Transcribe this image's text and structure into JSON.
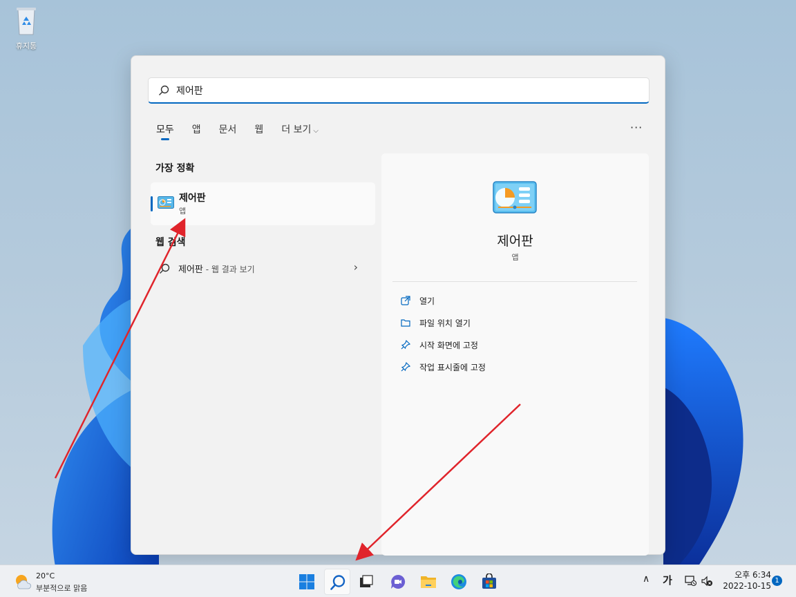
{
  "desktop": {
    "recycle_bin_label": "휴지통"
  },
  "search": {
    "query": "제어판",
    "tabs": [
      "모두",
      "앱",
      "문서",
      "웹",
      "더 보기"
    ],
    "active_tab": "모두",
    "more_options": "···"
  },
  "results": {
    "best_match_header": "가장 정확",
    "best_match": {
      "name": "제어판",
      "type": "앱"
    },
    "web_header": "웹 검색",
    "web_item": {
      "query": "제어판",
      "suffix": " - 웹 결과 보기"
    }
  },
  "detail": {
    "title": "제어판",
    "subtitle": "앱",
    "actions": [
      {
        "label": "열기",
        "icon": "open-external-icon"
      },
      {
        "label": "파일 위치 열기",
        "icon": "folder-icon"
      },
      {
        "label": "시작 화면에 고정",
        "icon": "pin-icon"
      },
      {
        "label": "작업 표시줄에 고정",
        "icon": "pin-icon"
      }
    ]
  },
  "taskbar": {
    "weather": {
      "temp": "20°C",
      "condition": "부분적으로 맑음"
    },
    "apps": [
      "start-icon",
      "search-icon",
      "task-view-icon",
      "chat-icon",
      "file-explorer-icon",
      "edge-icon",
      "store-icon"
    ],
    "active_app": "search-icon",
    "ime": "가",
    "clock": {
      "time": "오후 6:34",
      "date": "2022-10-15"
    },
    "notification_count": "1"
  },
  "colors": {
    "accent": "#0067c0",
    "annotation_arrow": "#e0242b"
  }
}
